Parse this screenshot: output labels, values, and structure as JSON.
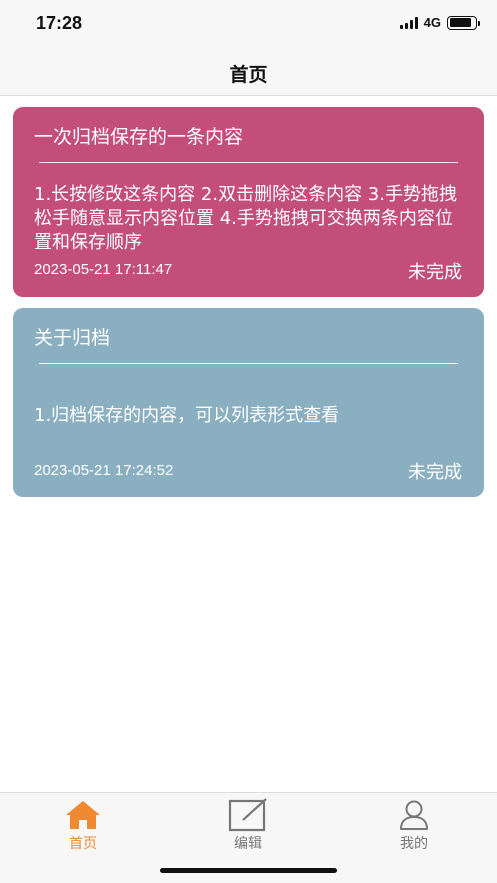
{
  "status_bar": {
    "time": "17:28",
    "network": "4G",
    "battery_level": 0.85,
    "signal_bars": 4
  },
  "header": {
    "title": "首页"
  },
  "cards": [
    {
      "title": "一次归档保存的一条内容",
      "body": "1.长按修改这条内容 2.双击删除这条内容 3.手势拖拽松手随意显示内容位置 4.手势拖拽可交换两条内容位置和保存顺序",
      "date": "2023-05-21 17:11:47",
      "status": "未完成",
      "color": "#c44e7a"
    },
    {
      "title": "关于归档",
      "body": "1.归档保存的内容，可以列表形式查看",
      "date": "2023-05-21 17:24:52",
      "status": "未完成",
      "color": "#8aafc0"
    }
  ],
  "tab_bar": {
    "items": [
      {
        "label": "首页",
        "icon": "home-icon",
        "active": true
      },
      {
        "label": "编辑",
        "icon": "edit-icon",
        "active": false
      },
      {
        "label": "我的",
        "icon": "profile-icon",
        "active": false
      }
    ],
    "active_color": "#f08a32",
    "inactive_color": "#777777"
  }
}
